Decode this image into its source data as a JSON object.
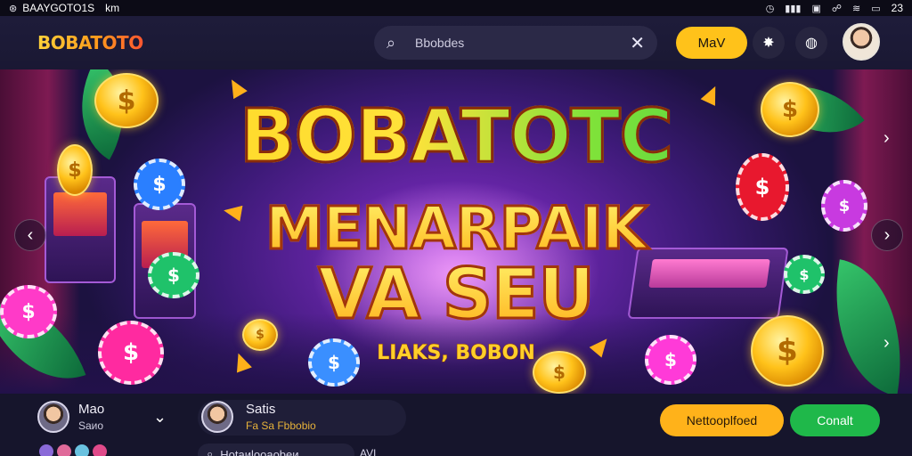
{
  "status_bar": {
    "left_text": "BAAYGOTO1S",
    "left_text2": "km",
    "time": "23"
  },
  "header": {
    "logo": "BOBATOTO",
    "search_value": "Bbobdes",
    "primary_button": "MaV"
  },
  "banner": {
    "line1": "BOBATOTC",
    "line2": "MENARPAIK",
    "line3": "VA SEU",
    "tagline": "LIAKS, BOBON"
  },
  "bottom": {
    "user1": {
      "name": "Mao",
      "sub": "Saиo"
    },
    "user2": {
      "name": "Satis",
      "sub": "Fа Sа Fbbobio"
    },
    "orange_button": "Nettooplfoed",
    "green_button": "Conalt",
    "bottom_search_text": "Hotаиlooаobeи",
    "bottom_search_tail": "AVL"
  },
  "colors": {
    "accent_yellow": "#ffc21a",
    "accent_orange": "#ffb21a",
    "accent_green": "#1fb84a",
    "header_bg": "#1e1c3a",
    "bottom_bg": "#16152c"
  }
}
